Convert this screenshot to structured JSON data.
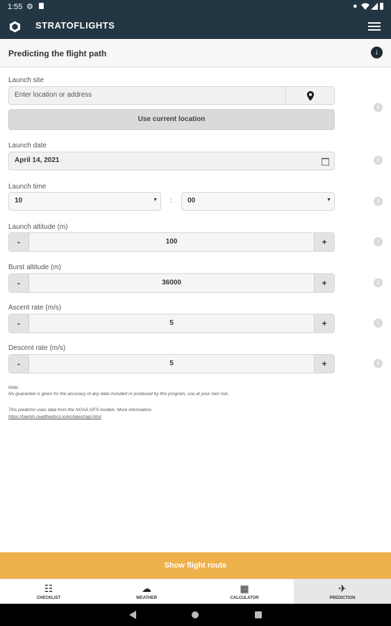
{
  "status_bar": {
    "time": "1:55"
  },
  "app_bar": {
    "title": "STRATOFLIGHTS"
  },
  "section": {
    "title": "Predicting the flight path"
  },
  "launch_site": {
    "label": "Launch site",
    "placeholder": "Enter location or address",
    "use_current_label": "Use current location"
  },
  "launch_date": {
    "label": "Launch date",
    "value": "April 14, 2021"
  },
  "launch_time": {
    "label": "Launch time",
    "hour": "10",
    "separator": ":",
    "minute": "00"
  },
  "launch_altitude": {
    "label": "Launch altitude (m)",
    "value": "100"
  },
  "burst_altitude": {
    "label": "Burst altitude (m)",
    "value": "36000"
  },
  "ascent_rate": {
    "label": "Ascent rate (m/s)",
    "value": "5"
  },
  "descent_rate": {
    "label": "Descent rate (m/s)",
    "value": "5"
  },
  "stepper": {
    "minus": "-",
    "plus": "+"
  },
  "notes": {
    "note_label": "Note:",
    "disclaimer": "No guarantee is given for the accuracy of any data included or produced by this program, use at your own risk.",
    "source": "This predictor uses data from the NOAA GFS models. More information:",
    "link": "https://tawhiri.readthedocs.io/en/latest/api.html"
  },
  "cta": {
    "label": "Show flight route"
  },
  "tabs": [
    {
      "label": "CHECKLIST",
      "icon": "checklist-icon"
    },
    {
      "label": "WEATHER",
      "icon": "weather-icon"
    },
    {
      "label": "CALCULATOR",
      "icon": "calculator-icon"
    },
    {
      "label": "PREDICTION",
      "icon": "airplane-icon",
      "active": true
    }
  ],
  "colors": {
    "header": "#233643",
    "accent": "#efb14b"
  }
}
